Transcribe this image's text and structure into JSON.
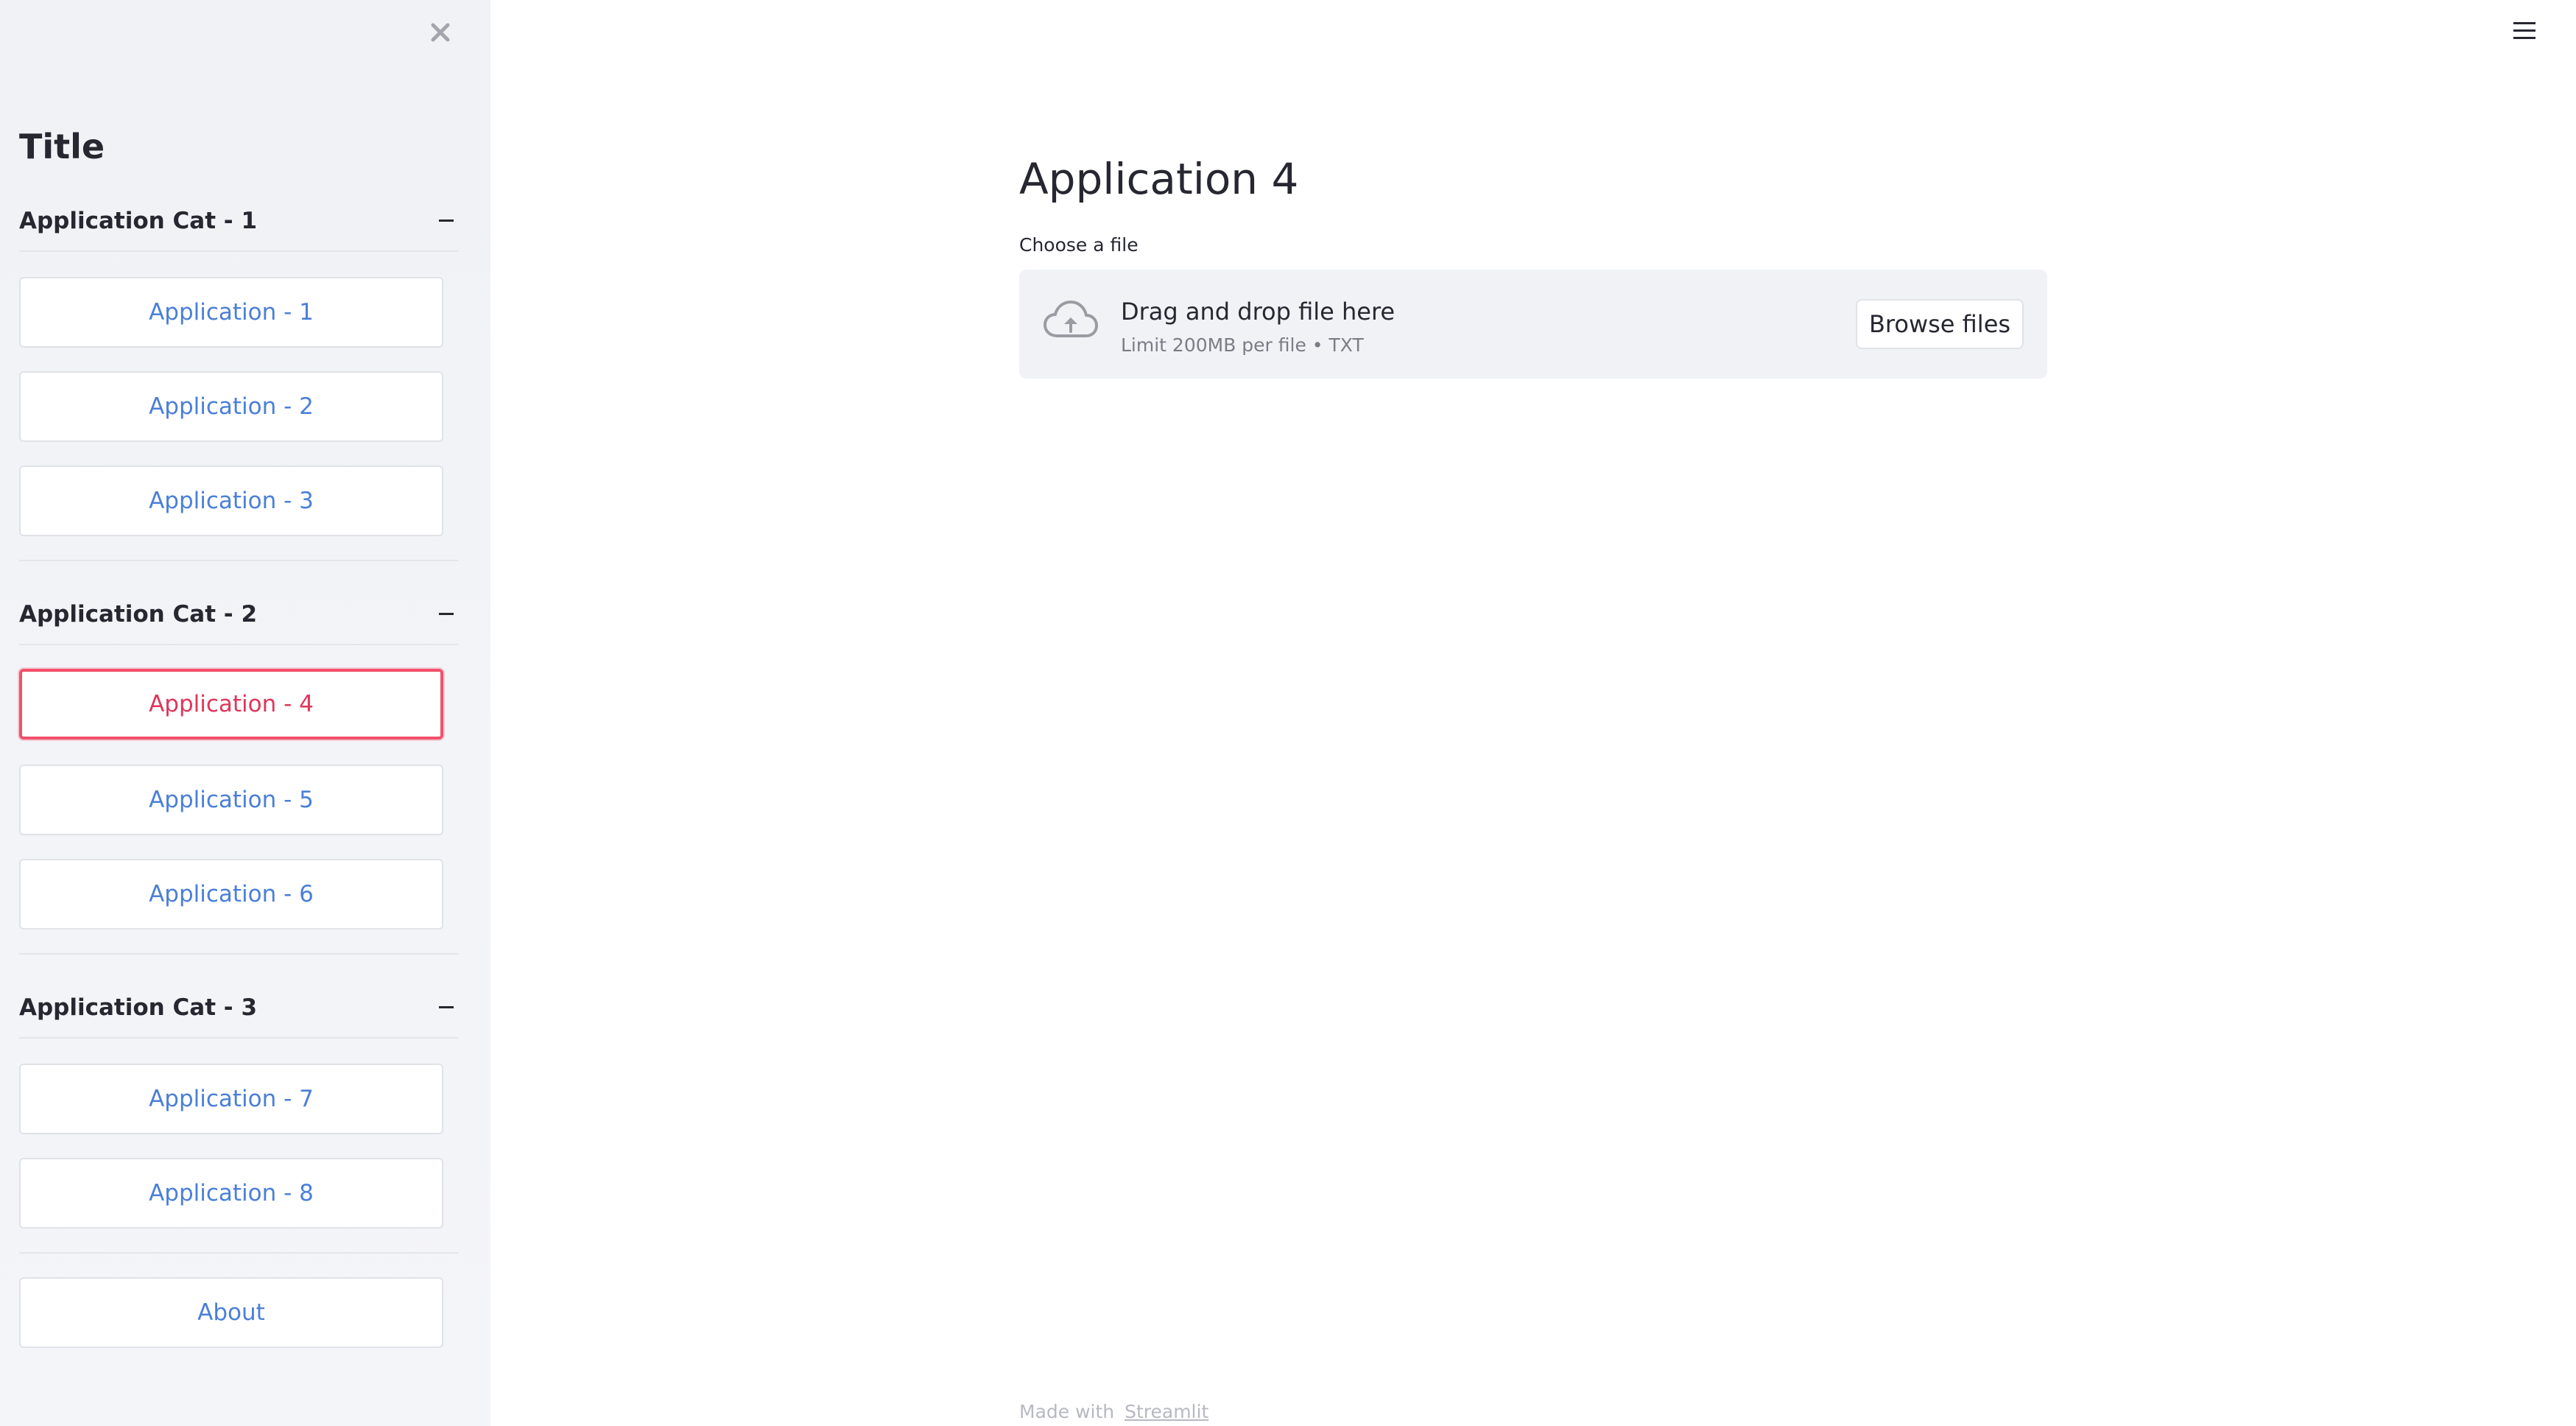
{
  "sidebar": {
    "title": "Title",
    "categories": [
      {
        "label": "Application Cat - 1",
        "toggle": "–",
        "items": [
          "Application - 1",
          "Application - 2",
          "Application - 3"
        ]
      },
      {
        "label": "Application Cat - 2",
        "toggle": "–",
        "items": [
          "Application - 4",
          "Application - 5",
          "Application - 6"
        ]
      },
      {
        "label": "Application Cat - 3",
        "toggle": "–",
        "items": [
          "Application - 7",
          "Application - 8"
        ]
      }
    ],
    "about_label": "About",
    "active_item": "Application - 4",
    "close_icon": "close-icon"
  },
  "main": {
    "title": "Application 4",
    "uploader": {
      "label": "Choose a file",
      "drop_title": "Drag and drop file here",
      "limit_text": "Limit 200MB per file • TXT",
      "browse_label": "Browse files",
      "icon": "cloud-upload-icon"
    }
  },
  "footer": {
    "made_with": "Made with",
    "link_text": "Streamlit"
  },
  "header": {
    "menu_icon": "hamburger-menu-icon"
  },
  "colors": {
    "sidebar_bg": "#f0f2f6",
    "link_blue": "#4a7fd8",
    "active_red": "#f2506a",
    "dropzone_bg": "#f0f2f6"
  }
}
